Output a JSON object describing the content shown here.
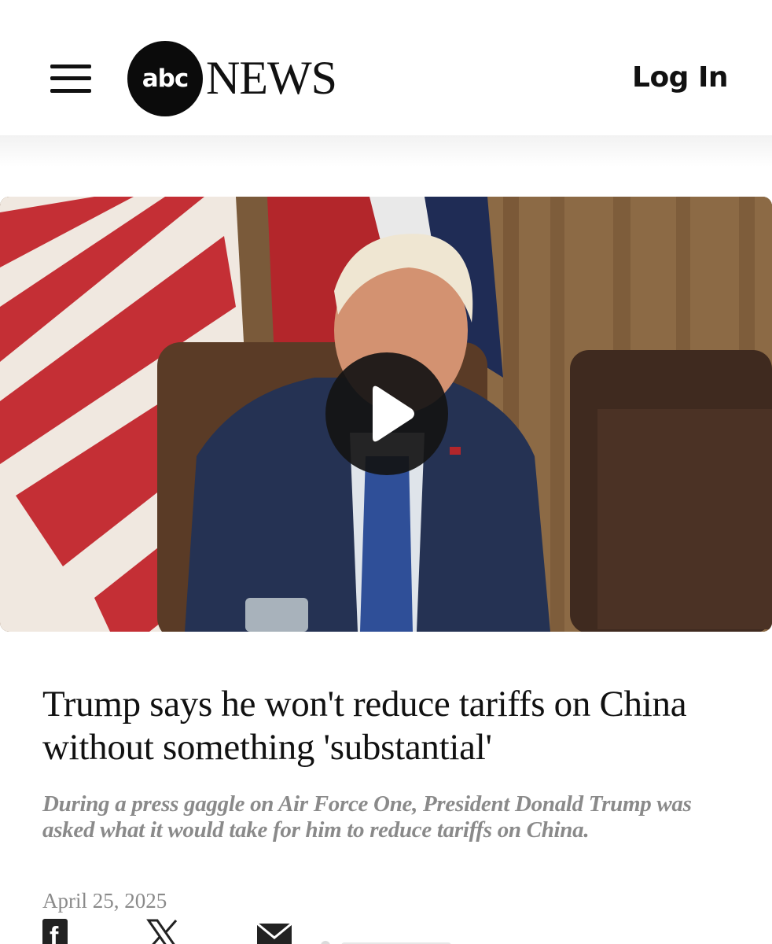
{
  "header": {
    "menu_label": "menu",
    "logo_abc": "abc",
    "logo_news": "NEWS",
    "login_label": "Log In"
  },
  "video": {
    "play_icon": "play-icon",
    "description": ""
  },
  "article": {
    "headline": "Trump says he won't reduce tariffs on China without something 'substantial'",
    "subheadline": "During a press gaggle on Air Force One, President Donald Trump was asked what it would take for him to reduce tariffs on China.",
    "date": "April 25, 2025"
  },
  "share": {
    "icons": [
      "facebook-icon",
      "x-icon",
      "email-icon",
      "more-icon"
    ]
  },
  "colors": {
    "brand_black": "#0b0b0b",
    "subhead_gray": "#8a8a8a",
    "text": "#111111"
  }
}
